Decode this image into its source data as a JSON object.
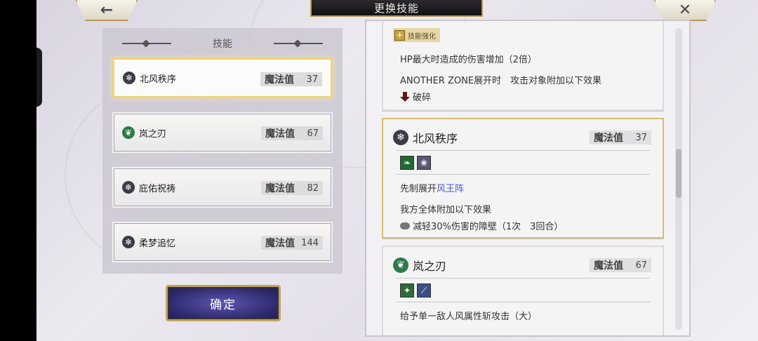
{
  "header": {
    "title": "更换技能",
    "back_icon": "←",
    "close_icon": "✕"
  },
  "left_panel": {
    "heading": "技能",
    "mp_label": "魔法值",
    "skills": [
      {
        "name": "北风秩序",
        "mp": "37",
        "icon": "snowflake-icon",
        "selected": true
      },
      {
        "name": "岚之刃",
        "mp": "67",
        "icon": "leaf-icon",
        "selected": false
      },
      {
        "name": "庇佑祝祷",
        "mp": "82",
        "icon": "snowflake-icon",
        "selected": false
      },
      {
        "name": "柔梦追忆",
        "mp": "144",
        "icon": "snowflake-icon",
        "selected": false
      }
    ],
    "confirm_label": "确定"
  },
  "detail_panel": {
    "card1": {
      "tag": "技能强化",
      "line1": "HP最大时造成的伤害增加（2倍）",
      "line2": "ANOTHER ZONE展开时　攻击对象附加以下效果",
      "line3": "破碎"
    },
    "card2": {
      "title": "北风秩序",
      "mp_label": "魔法值",
      "mp": "37",
      "line1_prefix": "先制展开",
      "line1_link": "风王阵",
      "line2": "我方全体附加以下效果",
      "line3": "减轻30%伤害的障壁（1次　3回合）"
    },
    "card3": {
      "title": "岚之刃",
      "mp_label": "魔法值",
      "mp": "67",
      "line1": "给予单一敌人风属性斩攻击（大）"
    }
  },
  "colors": {
    "accent_gold": "#d9bd70",
    "confirm_purple": "#2e2a6d",
    "link_blue": "#4b55d8"
  }
}
